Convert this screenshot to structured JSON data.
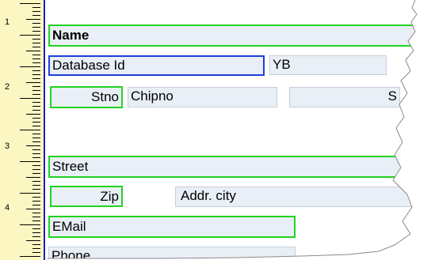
{
  "ruler": {
    "numbers": [
      "1",
      "2",
      "3",
      "4"
    ]
  },
  "fields": {
    "name": "Name",
    "database_id": "Database Id",
    "yb": "YB",
    "stno": "Stno",
    "chipno": "Chipno",
    "s_partial": "S",
    "street": "Street",
    "zip": "Zip",
    "addr_city": "Addr. city",
    "email": "EMail",
    "phone": "Phone"
  },
  "colors": {
    "ruler_bg": "#fbf6c2",
    "ruler_edge": "#1f1fc8",
    "field_bg": "#e9eff6",
    "selected_green": "#21d321",
    "selected_blue": "#1f3fd8"
  }
}
